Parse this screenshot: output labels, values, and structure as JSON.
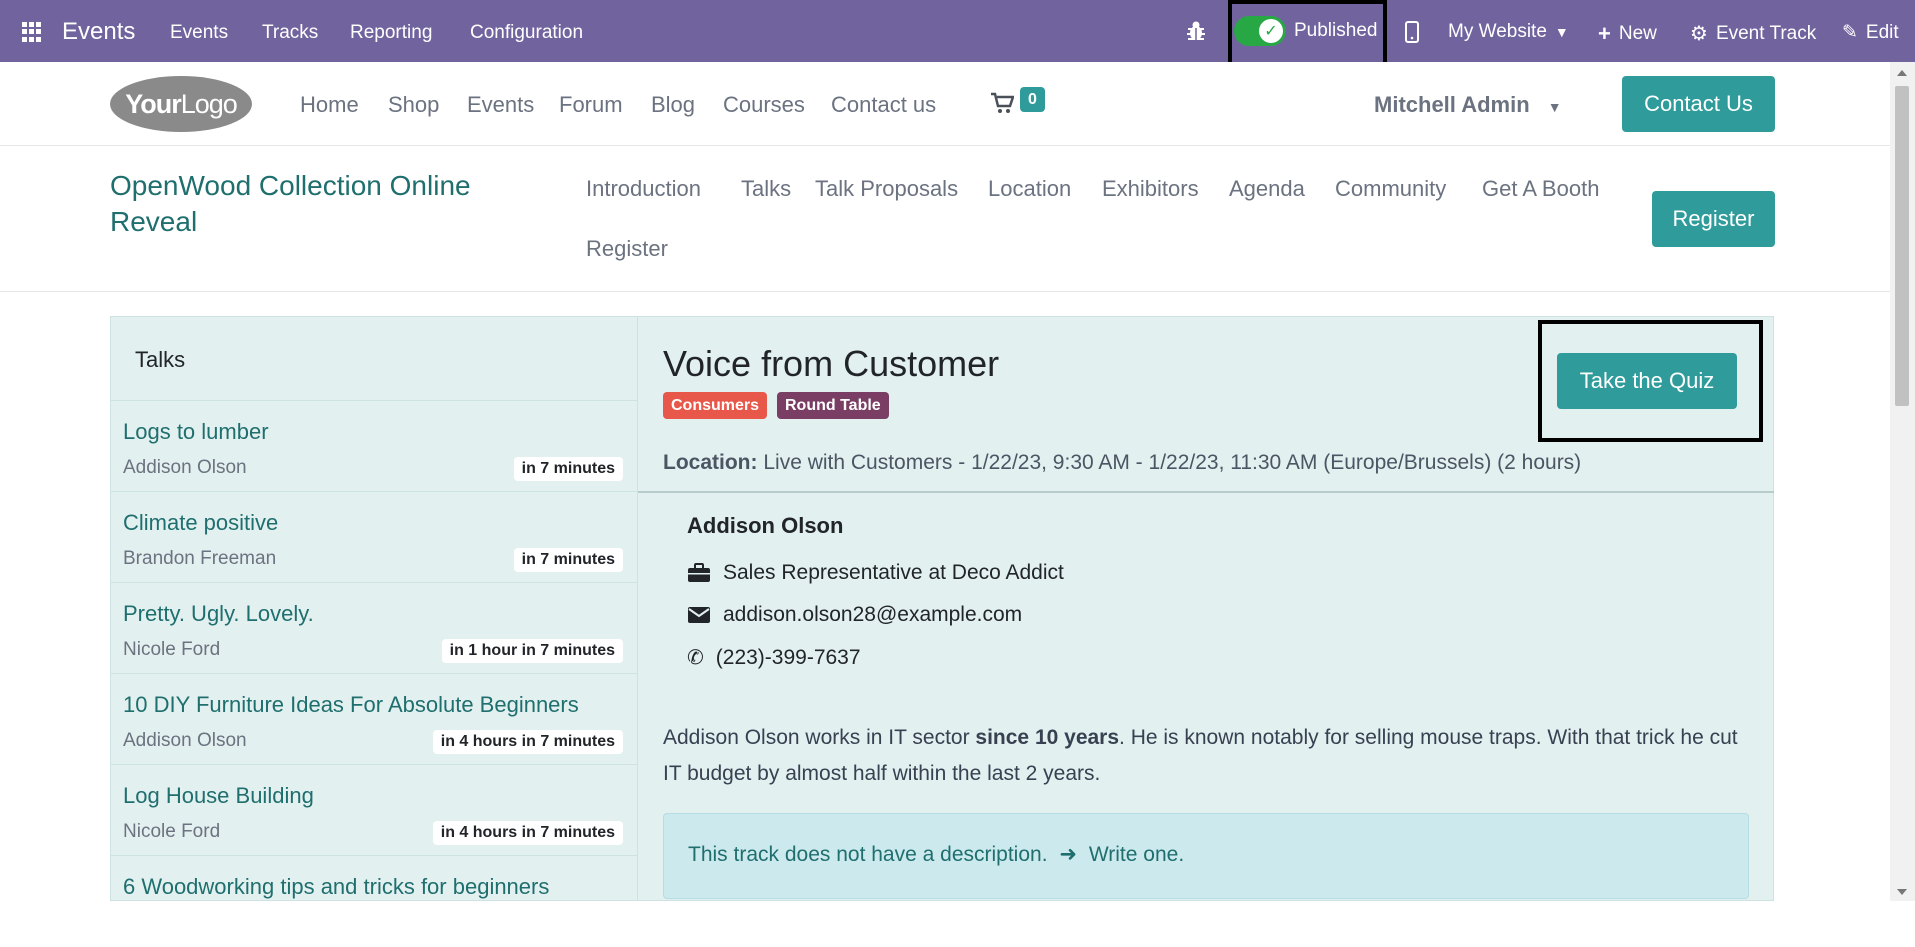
{
  "topbar": {
    "app_title": "Events",
    "menu": [
      "Events",
      "Tracks",
      "Reporting",
      "Configuration"
    ],
    "published_label": "Published",
    "website_label": "My Website",
    "new_label": "New",
    "event_track_label": "Event Track",
    "edit_label": "Edit",
    "bg_color": "#71639e"
  },
  "site": {
    "logo_text_bold": "Your",
    "logo_text": "Logo",
    "nav": [
      "Home",
      "Shop",
      "Events",
      "Forum",
      "Blog",
      "Courses",
      "Contact us"
    ],
    "cart_count": "0",
    "user_name": "Mitchell Admin",
    "contact_button": "Contact Us"
  },
  "event": {
    "title": "OpenWood Collection Online Reveal",
    "nav": [
      "Introduction",
      "Talks",
      "Talk Proposals",
      "Location",
      "Exhibitors",
      "Agenda",
      "Community",
      "Get A Booth",
      "Register"
    ],
    "register_button": "Register"
  },
  "sidebar": {
    "heading": "Talks",
    "talks": [
      {
        "title": "Logs to lumber",
        "speaker": "Addison Olson",
        "when": "in 7 minutes"
      },
      {
        "title": "Climate positive",
        "speaker": "Brandon Freeman",
        "when": "in 7 minutes"
      },
      {
        "title": "Pretty. Ugly. Lovely.",
        "speaker": "Nicole Ford",
        "when": "in 1 hour in 7 minutes"
      },
      {
        "title": "10 DIY Furniture Ideas For Absolute Beginners",
        "speaker": "Addison Olson",
        "when": "in 4 hours in 7 minutes"
      },
      {
        "title": "Log House Building",
        "speaker": "Nicole Ford",
        "when": "in 4 hours in 7 minutes"
      },
      {
        "title": "6 Woodworking tips and tricks for beginners",
        "speaker": "",
        "when": ""
      }
    ]
  },
  "talk": {
    "title": "Voice from Customer",
    "tags": [
      {
        "label": "Consumers",
        "color": "#e8584a"
      },
      {
        "label": "Round Table",
        "color": "#7a3e64"
      }
    ],
    "quiz_button": "Take the Quiz",
    "location_label": "Location:",
    "location_value": "Live with Customers - 1/22/23, 9:30 AM - 1/22/23, 11:30 AM (Europe/Brussels) (2 hours)",
    "speaker": {
      "name": "Addison Olson",
      "function": "Sales Representative at Deco Addict",
      "email": "addison.olson28@example.com",
      "phone": "(223)-399-7637"
    },
    "bio_before": "Addison Olson works in IT sector ",
    "bio_bold": "since 10 years",
    "bio_after": ". He is known notably for selling mouse traps. With that trick he cut IT budget by almost half within the last 2 years.",
    "no_description": "This track does not have a description.",
    "write_one": "Write one."
  }
}
